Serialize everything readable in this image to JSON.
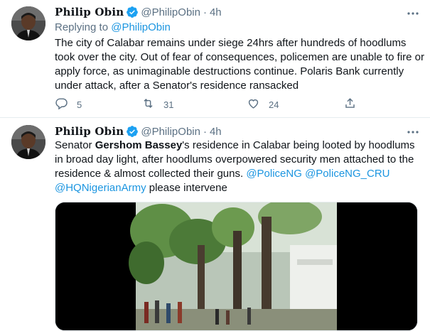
{
  "tweets": [
    {
      "author_name": "Philip Obin",
      "handle": "@PhilipObin",
      "separator": "·",
      "time": "4h",
      "replying_prefix": "Replying to",
      "replying_to": "@PhilipObin",
      "text": "The city of Calabar remains under siege 24hrs after hundreds of hoodlums took over the city. Out of fear of consequences, policemen are unable to fire or apply force, as unimaginable destructions continue. Polaris Bank currently under attack, after a Senator's residence ransacked",
      "reply_count": "5",
      "retweet_count": "31",
      "like_count": "24"
    },
    {
      "author_name": "Philip Obin",
      "handle": "@PhilipObin",
      "separator": "·",
      "time": "4h",
      "text_parts": {
        "p1": "Senator ",
        "bold": "Gershom Bassey",
        "p2": "'s residence in Calabar being looted by hoodlums in broad day light, after hoodlums overpowered security men attached to the residence & almost collected their guns. ",
        "m1": "@PoliceNG",
        "sp1": " ",
        "m2": "@PoliceNG_CRU",
        "sp2": " ",
        "m3": "@HQNigerianArmy",
        "p3": " please intervene"
      }
    }
  ],
  "icons": {
    "verified": "verified-badge-icon",
    "more": "more-dots-icon",
    "reply": "reply-icon",
    "retweet": "retweet-icon",
    "like": "heart-icon",
    "share": "share-icon"
  },
  "colors": {
    "link": "#1b95e0",
    "secondary_text": "#5b7083",
    "verified": "#1da1f2",
    "divider": "#e6ecf0"
  }
}
